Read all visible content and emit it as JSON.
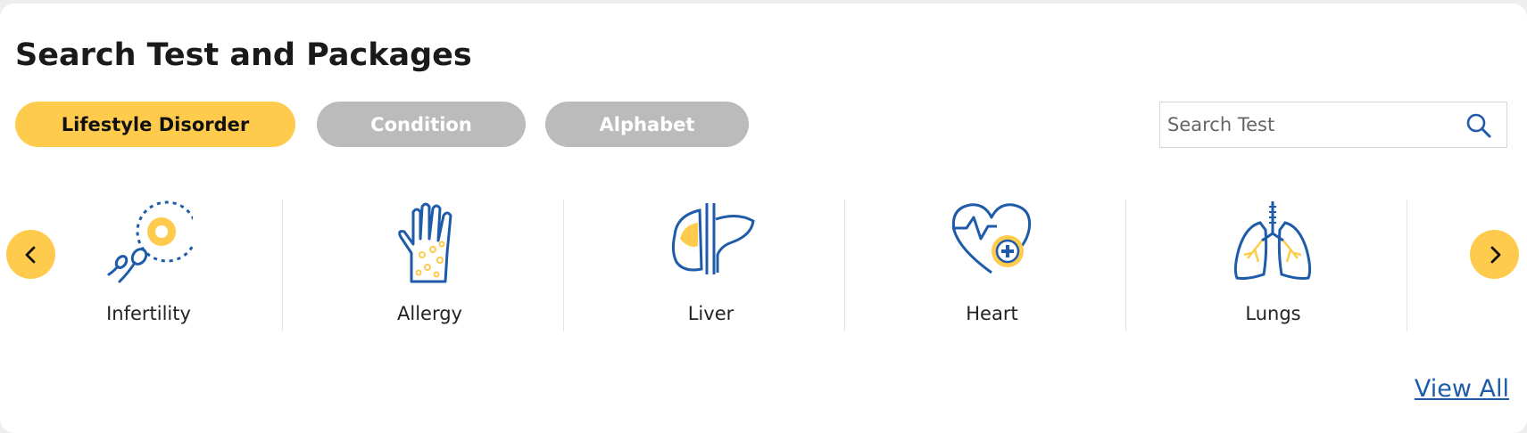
{
  "section": {
    "title": "Search Test and Packages",
    "view_all_label": "View All"
  },
  "tabs": [
    {
      "label": "Lifestyle Disorder",
      "active": true
    },
    {
      "label": "Condition",
      "active": false
    },
    {
      "label": "Alphabet",
      "active": false
    }
  ],
  "search": {
    "placeholder": "Search Test",
    "icon": "search-icon"
  },
  "carousel": {
    "prev_icon": "chevron-left-icon",
    "next_icon": "chevron-right-icon",
    "items": [
      {
        "label": "Infertility",
        "icon": "infertility-icon"
      },
      {
        "label": "Allergy",
        "icon": "allergy-icon"
      },
      {
        "label": "Liver",
        "icon": "liver-icon"
      },
      {
        "label": "Heart",
        "icon": "heart-icon"
      },
      {
        "label": "Lungs",
        "icon": "lungs-icon"
      }
    ]
  },
  "colors": {
    "accent": "#ffcb4c",
    "inactive_tab": "#bbbbbb",
    "icon_blue": "#1e5ba8",
    "link": "#1e5ba8"
  }
}
